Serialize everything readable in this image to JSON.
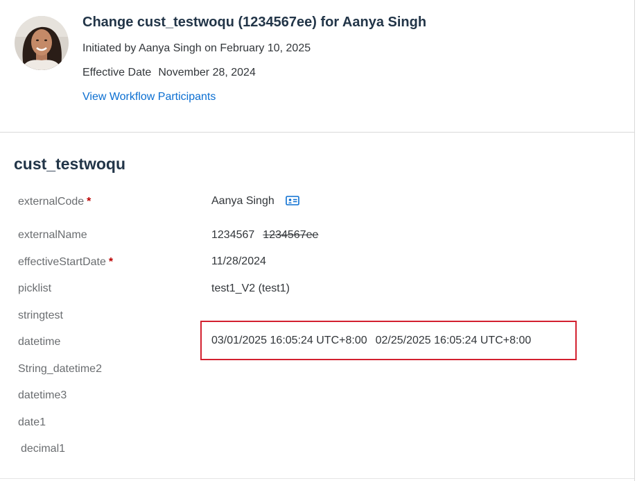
{
  "header": {
    "title": "Change cust_testwoqu (1234567ee) for Aanya Singh",
    "initiated": "Initiated by Aanya Singh on February 10, 2025",
    "effective_label": "Effective Date",
    "effective_value": "November 28, 2024",
    "workflow_link": "View Workflow Participants",
    "avatar_icon": "person-photo"
  },
  "section": {
    "title": "cust_testwoqu",
    "fields": [
      {
        "label": "externalCode",
        "required": "*",
        "value": "Aanya Singh",
        "icon": "business-card-icon"
      },
      {
        "label": "externalName",
        "value": "1234567",
        "old_value": "1234567ee"
      },
      {
        "label": "effectiveStartDate",
        "required": "*",
        "value": "11/28/2024"
      },
      {
        "label": "picklist",
        "value": "test1_V2 (test1)"
      },
      {
        "label": "stringtest",
        "value": ""
      },
      {
        "label": "datetime",
        "value": "03/01/2025 16:05:24 UTC+8:00",
        "old_value": "02/25/2025 16:05:24 UTC+8:00"
      },
      {
        "label": "String_datetime2",
        "value": ""
      },
      {
        "label": "datetime3",
        "value": ""
      },
      {
        "label": "date1",
        "value": ""
      },
      {
        "label": "decimal1",
        "value": ""
      }
    ]
  },
  "colors": {
    "link": "#0a6ed1",
    "required": "#bb0000",
    "highlight_border": "#d3202f",
    "title": "#223548",
    "label": "#6a6d70"
  }
}
